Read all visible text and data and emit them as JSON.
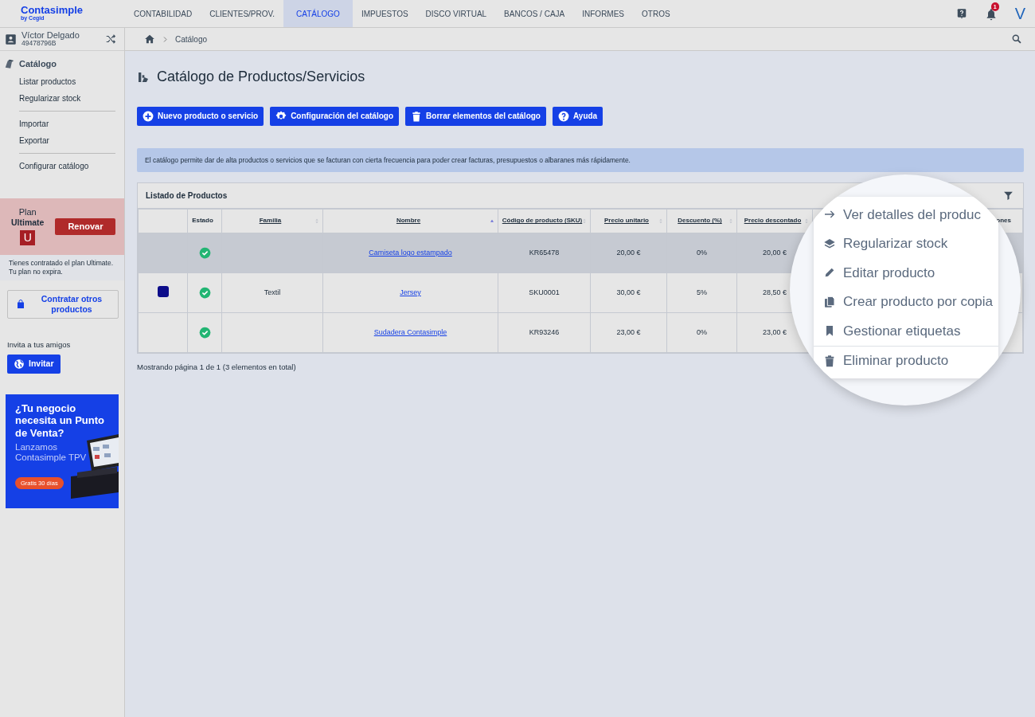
{
  "brand": {
    "name": "Contasimple",
    "tagline": "by Cegid"
  },
  "nav": [
    {
      "label": "CONTABILIDAD",
      "selected": false
    },
    {
      "label": "CLIENTES/PROV.",
      "selected": false
    },
    {
      "label": "CATÁLOGO",
      "selected": true
    },
    {
      "label": "IMPUESTOS",
      "selected": false
    },
    {
      "label": "DISCO VIRTUAL",
      "selected": false
    },
    {
      "label": "BANCOS / CAJA",
      "selected": false
    },
    {
      "label": "INFORMES",
      "selected": false
    },
    {
      "label": "OTROS",
      "selected": false
    }
  ],
  "notifications": {
    "count": "1"
  },
  "user_initial": "V",
  "user": {
    "name": "Víctor Delgado",
    "id": "49478796B"
  },
  "breadcrumb": [
    "Catálogo"
  ],
  "sidebar": {
    "section": "Catálogo",
    "groups": [
      [
        "Listar productos",
        "Regularizar stock"
      ],
      [
        "Importar",
        "Exportar"
      ],
      [
        "Configurar catálogo"
      ]
    ]
  },
  "plan": {
    "label": "Plan",
    "name": "Ultimate",
    "badge": "U",
    "button": "Renovar",
    "note": "Tienes contratado el plan Ultimate. Tu plan no expira."
  },
  "contract_button": "Contratar otros productos",
  "invite": {
    "label": "Invita a tus amigos",
    "button": "Invitar"
  },
  "promo": {
    "headline": "¿Tu negocio necesita un Punto de Venta?",
    "text": "Lanzamos Contasimple TPV",
    "cta": "Gratis 30 días"
  },
  "page_title": "Catálogo de Productos/Servicios",
  "actions": [
    "Nuevo producto o servicio",
    "Configuración del catálogo",
    "Borrar elementos del catálogo",
    "Ayuda"
  ],
  "info": "El catálogo permite dar de alta productos o servicios que se facturan con cierta frecuencia para poder crear facturas, presupuestos o albaranes más rápidamente.",
  "table": {
    "title": "Listado de Productos",
    "columns": [
      {
        "label": "Estado",
        "kind": "plain"
      },
      {
        "label": "Familia",
        "kind": "sort",
        "sorted": false
      },
      {
        "label": "Nombre",
        "kind": "sort",
        "sorted": true
      },
      {
        "label": "Código de producto (SKU)",
        "kind": "sort",
        "sorted": false
      },
      {
        "label": "Precio unitario",
        "kind": "sort",
        "sorted": false
      },
      {
        "label": "Descuento (%)",
        "kind": "sort",
        "sorted": false
      },
      {
        "label": "Precio descontado",
        "kind": "sort",
        "sorted": false
      },
      {
        "label": "ones",
        "kind": "plain"
      }
    ],
    "rows": [
      {
        "selected": true,
        "familia": "",
        "nombre": "Camiseta logo estampado",
        "sku": "KR65478",
        "precio": "20,00 €",
        "descuento": "0%",
        "descontado": "20,00 €"
      },
      {
        "selected": false,
        "color": "#0d0d8a",
        "familia": "Textil",
        "nombre": "Jersey",
        "sku": "SKU0001",
        "precio": "30,00 €",
        "descuento": "5%",
        "descontado": "28,50 €"
      },
      {
        "selected": false,
        "familia": "",
        "nombre": "Sudadera Contasimple",
        "sku": "KR93246",
        "precio": "23,00 €",
        "descuento": "0%",
        "descontado": "23,00 €"
      }
    ],
    "footer": "Mostrando página 1 de 1 (3 elementos en total)"
  },
  "magnifier": {
    "menu": [
      {
        "label": "Ver detalles del produc",
        "divider": false
      },
      {
        "label": "Regularizar stock",
        "divider": false
      },
      {
        "label": "Editar producto",
        "divider": false
      },
      {
        "label": "Crear producto por copia",
        "divider": false
      },
      {
        "label": "Gestionar etiquetas",
        "divider": false
      },
      {
        "label": "Eliminar producto",
        "divider": true
      }
    ]
  }
}
